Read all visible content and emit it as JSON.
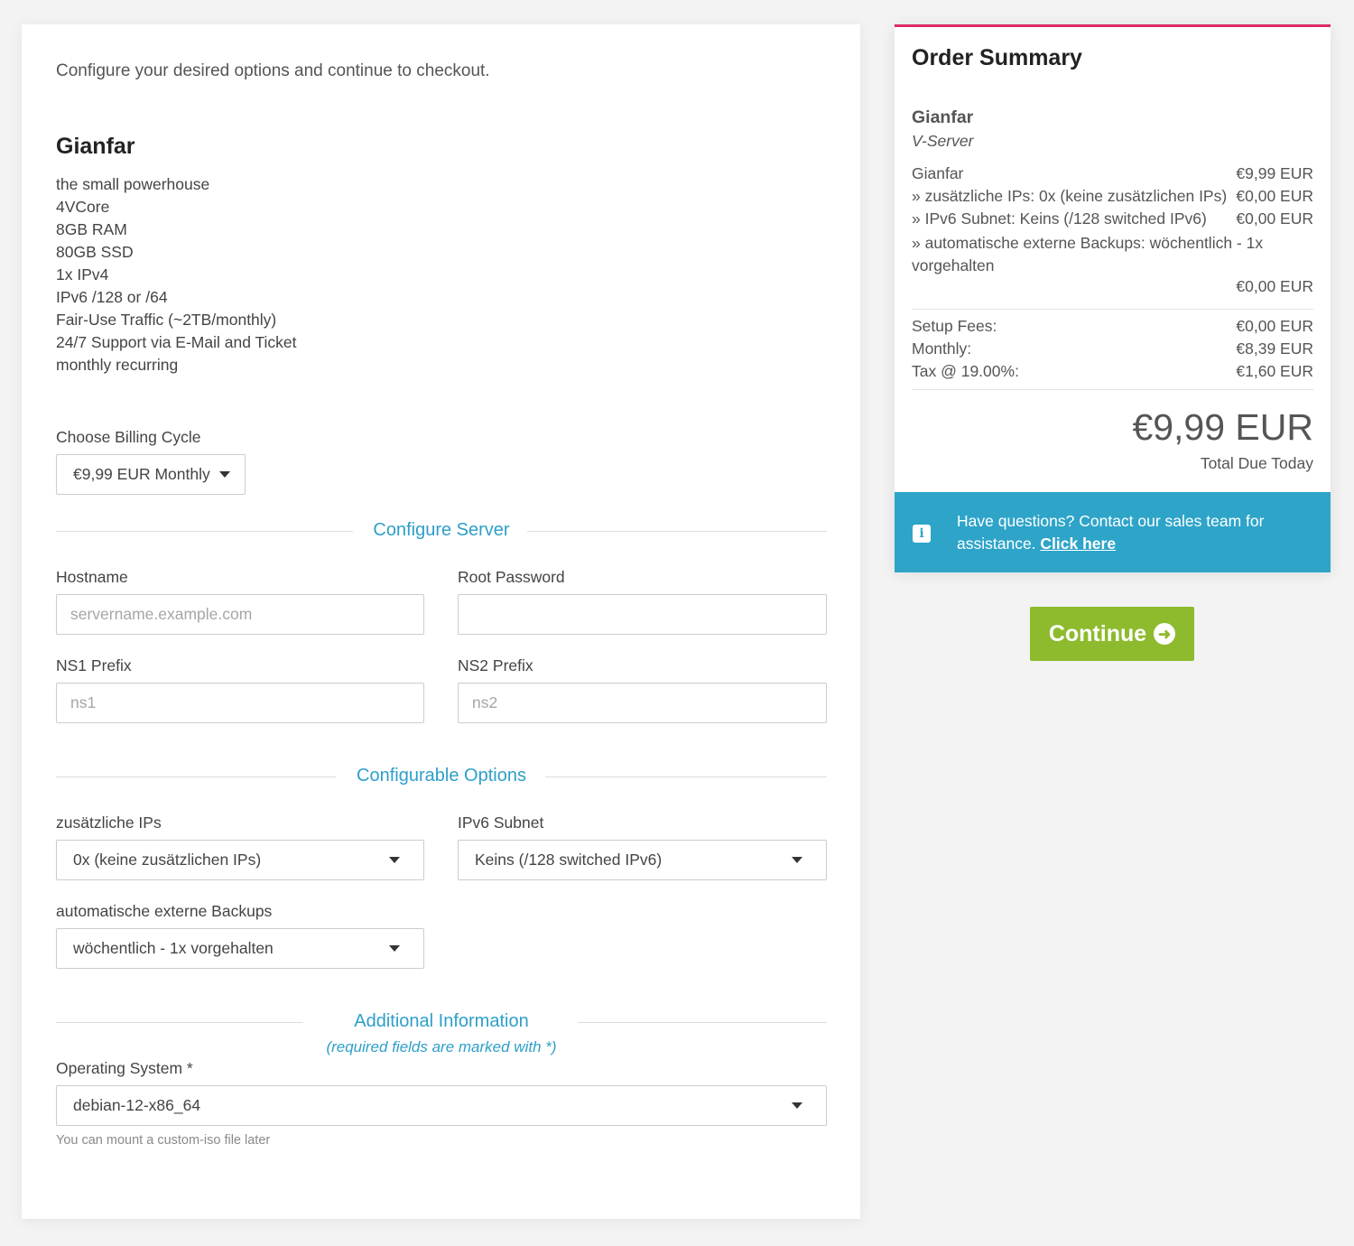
{
  "intro_text": "Configure your desired options and continue to checkout.",
  "product": {
    "name": "Gianfar",
    "description": [
      "the small powerhouse",
      "4VCore",
      "8GB RAM",
      "80GB SSD",
      "1x IPv4",
      "IPv6 /128 or /64",
      "Fair-Use Traffic (~2TB/monthly)",
      "24/7 Support via E-Mail and Ticket",
      "monthly recurring"
    ]
  },
  "billing": {
    "label": "Choose Billing Cycle",
    "selected": "€9,99 EUR Monthly"
  },
  "configure_server": {
    "heading": "Configure Server",
    "hostname": {
      "label": "Hostname",
      "placeholder": "servername.example.com",
      "value": ""
    },
    "root_password": {
      "label": "Root Password",
      "value": ""
    },
    "ns1": {
      "label": "NS1 Prefix",
      "placeholder": "ns1",
      "value": ""
    },
    "ns2": {
      "label": "NS2 Prefix",
      "placeholder": "ns2",
      "value": ""
    }
  },
  "configurable_options": {
    "heading": "Configurable Options",
    "extra_ips": {
      "label": "zusätzliche IPs",
      "selected": "0x (keine zusätzlichen IPs)"
    },
    "ipv6": {
      "label": "IPv6 Subnet",
      "selected": "Keins (/128 switched IPv6)"
    },
    "backups": {
      "label": "automatische externe Backups",
      "selected": "wöchentlich - 1x vorgehalten"
    }
  },
  "additional_info": {
    "heading": "Additional Information",
    "note": "(required fields are marked with *)",
    "os": {
      "label": "Operating System *",
      "selected": "debian-12-x86_64",
      "help": "You can mount a custom-iso file later"
    }
  },
  "summary": {
    "title": "Order Summary",
    "product_name": "Gianfar",
    "product_group": "V-Server",
    "line_items": [
      {
        "label": "Gianfar",
        "amount": "€9,99 EUR"
      },
      {
        "label": " » zusätzliche IPs: 0x (keine zusätzlichen IPs)",
        "amount": "€0,00 EUR"
      },
      {
        "label": " » IPv6 Subnet: Keins (/128 switched IPv6)",
        "amount": "€0,00 EUR"
      }
    ],
    "backup_item": {
      "label": " » automatische externe Backups: wöchentlich - 1x vorgehalten",
      "amount": "€0,00 EUR"
    },
    "fees": [
      {
        "label": "Setup Fees:",
        "amount": "€0,00 EUR"
      },
      {
        "label": "Monthly:",
        "amount": "€8,39 EUR"
      },
      {
        "label": "Tax @ 19.00%:",
        "amount": "€1,60 EUR"
      }
    ],
    "total_amount": "€9,99 EUR",
    "total_label": "Total Due Today"
  },
  "info_box": {
    "icon": "info-icon",
    "text": "Have questions? Contact our sales team for assistance. ",
    "link": "Click here"
  },
  "continue": {
    "label": "Continue",
    "icon": "arrow-circle-right-icon"
  },
  "colors": {
    "accent": "#2e9fc9",
    "summary_border": "#dc2a69",
    "info_bg": "#2ea4c9",
    "continue_bg": "#8dbb2d"
  }
}
